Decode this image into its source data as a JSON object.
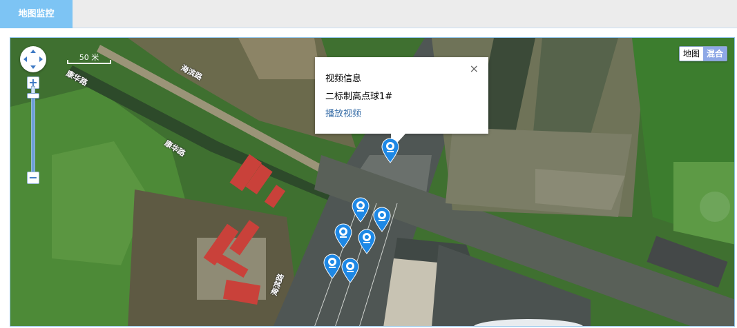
{
  "tabs": [
    {
      "label": "地图监控",
      "active": true
    }
  ],
  "map": {
    "scale_label": "50 米",
    "road_labels": [
      "康华路",
      "海滨路",
      "康华路",
      "海滨路"
    ],
    "map_type": {
      "map_label": "地图",
      "hybrid_label": "混合",
      "selected": "混合"
    },
    "zoom_level_fraction": 0.88,
    "popup": {
      "title": "视频信息",
      "camera_name": "二标制高点球1#",
      "play_link": "播放视频",
      "close_symbol": "×"
    },
    "camera_markers_count": 7
  },
  "colors": {
    "tab_active": "#7dc4f4",
    "marker": "#1e88e5",
    "map_type_selected": "#8ea8e6",
    "link": "#3a6fa8"
  }
}
